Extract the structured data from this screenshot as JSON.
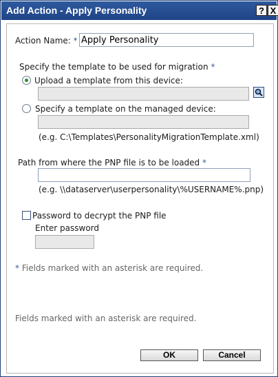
{
  "window": {
    "title": "Add Action - Apply Personality",
    "help_glyph": "?",
    "close_glyph": "X"
  },
  "form": {
    "action_name_label": "Action Name:",
    "required_mark": "*",
    "action_name_value": "Apply Personality",
    "template_section_label": "Specify the template to be used for migration",
    "radio_upload_label": "Upload a template from this device:",
    "radio_managed_label": "Specify a template on the managed device:",
    "managed_example": "(e.g. C:\\Templates\\PersonalityMigrationTemplate.xml)",
    "pnp_path_label": "Path from where the PNP file is to be loaded",
    "pnp_example": "(e.g. \\\\dataserver\\userpersonality\\%USERNAME%.pnp)",
    "password_checkbox_label": "Password to decrypt the PNP file",
    "enter_password_label": "Enter password",
    "required_note": "Fields marked with an asterisk are required.",
    "footer_note": "Fields marked with an asterisk are required."
  },
  "buttons": {
    "ok_label": "OK",
    "cancel_label": "Cancel"
  },
  "icons": {
    "browse": "search-icon",
    "radio_selected": "radio-selected-icon"
  },
  "colors": {
    "titlebar": "#1f4487",
    "required": "#3b5c9e",
    "radio_dot": "#2f8a2f"
  }
}
